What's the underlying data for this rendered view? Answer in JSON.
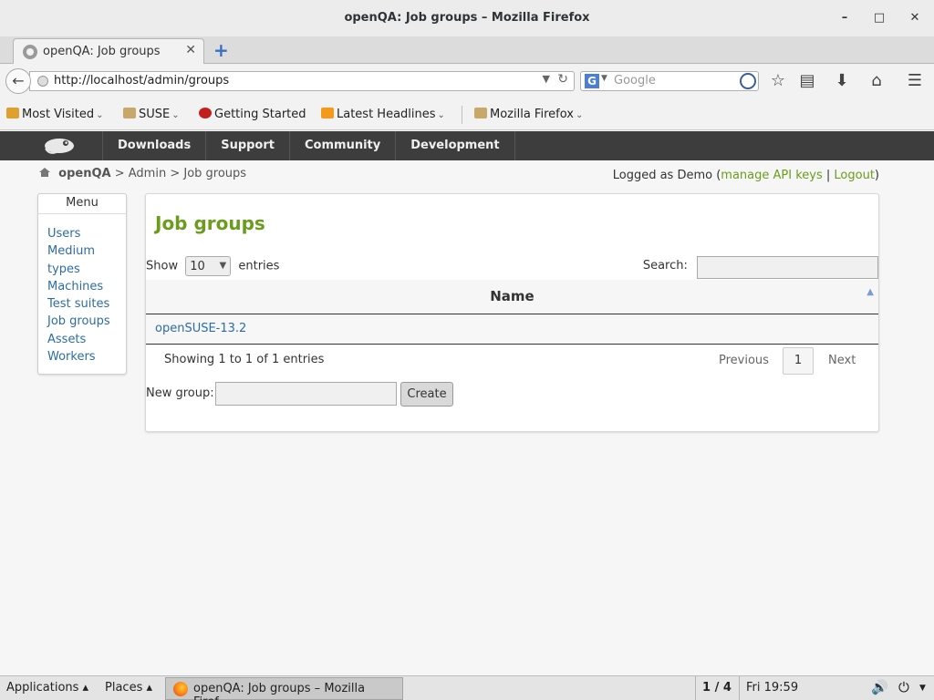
{
  "window": {
    "title": "openQA: Job groups – Mozilla Firefox",
    "minimize": "–",
    "maximize": "□",
    "close": "✕"
  },
  "tabs": [
    {
      "label": "openQA: Job groups",
      "close": "✕"
    }
  ],
  "new_tab": "+",
  "navbar": {
    "back": "←",
    "url": "http://localhost/admin/groups",
    "search_engine": "G",
    "search_placeholder": "Google"
  },
  "bookmarks": [
    {
      "label": "Most Visited",
      "chevron": "⌄"
    },
    {
      "label": "SUSE",
      "chevron": "⌄"
    },
    {
      "label": "Getting Started"
    },
    {
      "label": "Latest Headlines",
      "chevron": "⌄"
    },
    {
      "label": "Mozilla Firefox",
      "chevron": "⌄"
    }
  ],
  "site_nav": [
    "Downloads",
    "Support",
    "Community",
    "Development"
  ],
  "breadcrumb": {
    "root": "openQA",
    "sep": ">",
    "admin": "Admin",
    "current": "Job groups"
  },
  "login": {
    "prefix": "Logged as Demo (",
    "manage": "manage API keys",
    "divider": " | ",
    "logout": "Logout",
    "suffix": ")"
  },
  "menu": {
    "title": "Menu",
    "items": [
      "Users",
      "Medium",
      "types",
      "Machines",
      "Test suites",
      "Job groups",
      "Assets",
      "Workers"
    ]
  },
  "main": {
    "title": "Job groups",
    "show_label": "Show",
    "show_value": "10",
    "entries_label": "entries",
    "search_label": "Search:",
    "column_name": "Name",
    "rows": [
      "openSUSE-13.2"
    ],
    "info": "Showing 1 to 1 of 1 entries",
    "previous": "Previous",
    "current_page": "1",
    "next": "Next",
    "new_group_label": "New group:",
    "create": "Create"
  },
  "taskbar": {
    "applications": "Applications ▴",
    "places": "Places ▴",
    "task": "openQA: Job groups – Mozilla Firef...",
    "workspace": "1 / 4",
    "clock": "Fri 19:59"
  },
  "colors": {
    "accent_green": "#6b9c1d",
    "link_blue": "#2d6da3",
    "site_bar": "#3d3d3d"
  }
}
